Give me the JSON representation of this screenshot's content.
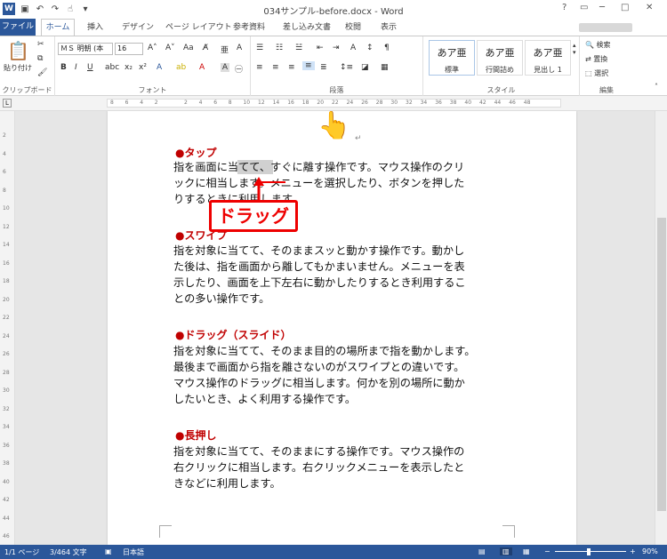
{
  "titlebar": {
    "title": "034サンプル-before.docx - Word",
    "app_icon": "W",
    "controls": [
      "?",
      "▭",
      "─",
      "□",
      "✕"
    ]
  },
  "tabs": {
    "file": "ファイル",
    "home": "ホーム",
    "insert": "挿入",
    "design": "デザイン",
    "layout": "ページ レイアウト",
    "references": "参考資料",
    "mailings": "差し込み文書",
    "review": "校閲",
    "view": "表示"
  },
  "ribbon": {
    "clipboard": {
      "label": "クリップボード",
      "paste": "貼り付け"
    },
    "font": {
      "label": "フォント",
      "name": "ＭＳ 明朝 (本",
      "size": "16"
    },
    "paragraph": {
      "label": "段落"
    },
    "styles": {
      "label": "スタイル",
      "items": [
        {
          "sample": "あア亜",
          "name": "標準"
        },
        {
          "sample": "あア亜",
          "name": "行間詰め"
        },
        {
          "sample": "あア亜",
          "name": "見出し 1"
        }
      ]
    },
    "editing": {
      "label": "編集",
      "find": "検索",
      "replace": "置換",
      "select": "選択"
    }
  },
  "ruler": {
    "ticks": [
      "8",
      "6",
      "4",
      "2",
      "",
      "2",
      "4",
      "6",
      "8",
      "10",
      "12",
      "14",
      "16",
      "18",
      "20",
      "22",
      "24",
      "26",
      "28",
      "30",
      "32",
      "34",
      "36",
      "38",
      "40",
      "42",
      "44",
      "46",
      "48"
    ]
  },
  "vruler": {
    "ticks": [
      "2",
      "4",
      "6",
      "8",
      "10",
      "12",
      "14",
      "16",
      "18",
      "20",
      "22",
      "24",
      "26",
      "28",
      "30",
      "32",
      "34",
      "36",
      "38",
      "40",
      "42",
      "44",
      "46"
    ]
  },
  "document": {
    "sections": [
      {
        "heading": "●タップ",
        "lines": [
          "指を画面に当てて、すぐに離す操作です。マウス操作のクリ",
          "ックに相当します。メニューを選択したり、ボタンを押した",
          "りするときに利用します。"
        ]
      },
      {
        "heading": "●スワイプ",
        "lines": [
          "指を対象に当てて、そのままスッと動かす操作です。動かし",
          "た後は、指を画面から離してもかまいません。メニューを表",
          "示したり、画面を上下左右に動かしたりするとき利用するこ",
          "との多い操作です。"
        ]
      },
      {
        "heading": "●ドラッグ（スライド）",
        "lines": [
          "指を対象に当てて、そのまま目的の場所まで指を動かします。",
          "最後まで画面から指を離さないのがスワイプとの違いです。",
          "マウス操作のドラッグに相当します。何かを別の場所に動か",
          "したいとき、よく利用する操作です。"
        ]
      },
      {
        "heading": "●長押し",
        "lines": [
          "指を対象に当てて、そのままにする操作です。マウス操作の",
          "右クリックに相当します。右クリックメニューを表示したと",
          "きなどに利用します。"
        ]
      }
    ],
    "callout": "ドラッグ",
    "paragraph_mark": "↵"
  },
  "statusbar": {
    "page": "1/1 ページ",
    "words": "3/464 文字",
    "language": "日本語",
    "zoom": "90%"
  },
  "colors": {
    "accent": "#2b579a",
    "heading": "#c00000",
    "callout": "#e00000"
  }
}
